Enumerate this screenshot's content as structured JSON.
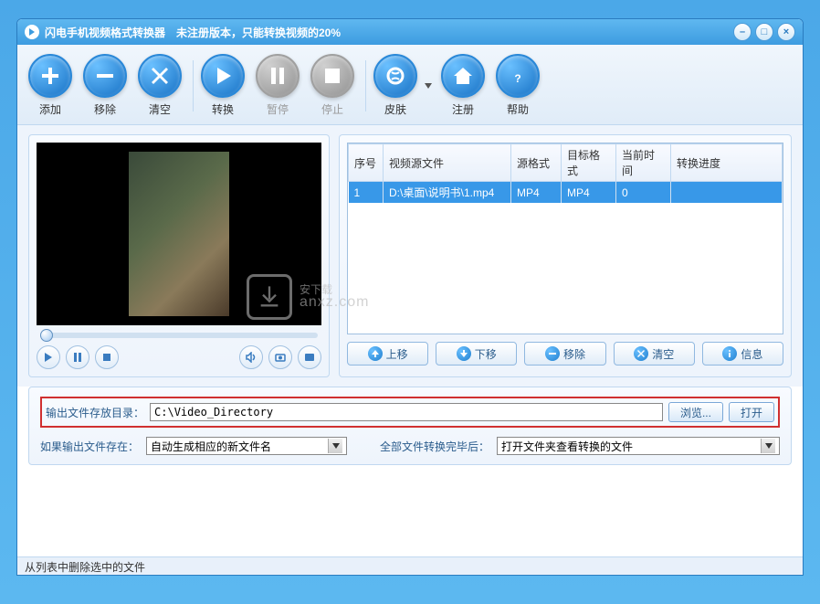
{
  "titlebar": {
    "title": "闪电手机视频格式转换器　未注册版本，只能转换视频的20%"
  },
  "toolbar": {
    "add": "添加",
    "remove": "移除",
    "clear": "清空",
    "convert": "转换",
    "pause": "暂停",
    "stop": "停止",
    "skin": "皮肤",
    "register": "注册",
    "help": "帮助"
  },
  "table": {
    "headers": {
      "index": "序号",
      "source": "视频源文件",
      "srcfmt": "源格式",
      "dstfmt": "目标格式",
      "curtime": "当前时间",
      "progress": "转换进度"
    },
    "rows": [
      {
        "index": "1",
        "source": "D:\\桌面\\说明书\\1.mp4",
        "srcfmt": "MP4",
        "dstfmt": "MP4",
        "curtime": "0",
        "progress": ""
      }
    ]
  },
  "list_actions": {
    "up": "上移",
    "down": "下移",
    "remove": "移除",
    "clear": "清空",
    "info": "信息"
  },
  "bottom": {
    "outdir_label": "输出文件存放目录：",
    "outdir_value": "C:\\Video_Directory",
    "browse": "浏览...",
    "open": "打开",
    "exists_label": "如果输出文件存在：",
    "exists_value": "自动生成相应的新文件名",
    "after_label": "全部文件转换完毕后：",
    "after_value": "打开文件夹查看转换的文件"
  },
  "status": "从列表中删除选中的文件",
  "watermark": {
    "main": "安下载",
    "sub": "anxz.com"
  }
}
